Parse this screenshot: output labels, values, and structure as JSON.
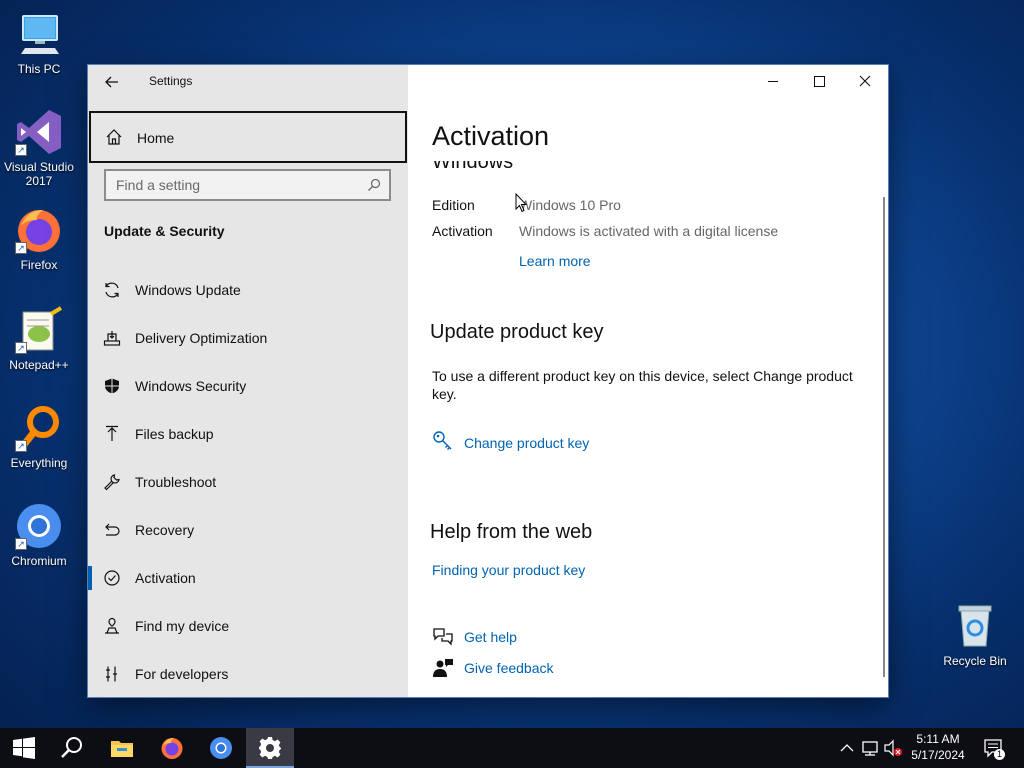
{
  "desktop": {
    "icons": [
      {
        "label": "This PC"
      },
      {
        "label": "Visual Studio 2017"
      },
      {
        "label": "Firefox"
      },
      {
        "label": "Notepad++"
      },
      {
        "label": "Everything"
      },
      {
        "label": "Chromium"
      },
      {
        "label": "Recycle Bin"
      }
    ]
  },
  "window": {
    "app_title": "Settings",
    "controls": {
      "minimize": "minimize",
      "maximize": "maximize",
      "close": "close"
    }
  },
  "nav": {
    "home_label": "Home",
    "search_placeholder": "Find a setting",
    "section_header": "Update & Security",
    "items": [
      {
        "label": "Windows Update",
        "icon": "sync-icon"
      },
      {
        "label": "Delivery Optimization",
        "icon": "delivery-optimization-icon"
      },
      {
        "label": "Windows Security",
        "icon": "shield-icon"
      },
      {
        "label": "Files backup",
        "icon": "backup-icon"
      },
      {
        "label": "Troubleshoot",
        "icon": "wrench-icon"
      },
      {
        "label": "Recovery",
        "icon": "recovery-icon"
      },
      {
        "label": "Activation",
        "icon": "check-circle-icon",
        "selected": true
      },
      {
        "label": "Find my device",
        "icon": "find-device-icon"
      },
      {
        "label": "For developers",
        "icon": "developer-icon"
      }
    ]
  },
  "content": {
    "page_title": "Activation",
    "windows_heading": "Windows",
    "edition_label": "Edition",
    "edition_value": "Windows 10 Pro",
    "activation_label": "Activation",
    "activation_value": "Windows is activated with a digital license",
    "learn_more": "Learn more",
    "update_key_heading": "Update product key",
    "update_key_text": "To use a different product key on this device, select Change product key.",
    "change_key_link": "Change product key",
    "help_heading": "Help from the web",
    "finding_key_link": "Finding your product key",
    "get_help": "Get help",
    "give_feedback": "Give feedback"
  },
  "taskbar": {
    "time": "5:11 AM",
    "date": "5/17/2024",
    "notification_count": "1"
  },
  "colors": {
    "accent": "#0063b1",
    "nav_bg": "#e6e6e6",
    "taskbar_bg": "#0d0d14"
  }
}
